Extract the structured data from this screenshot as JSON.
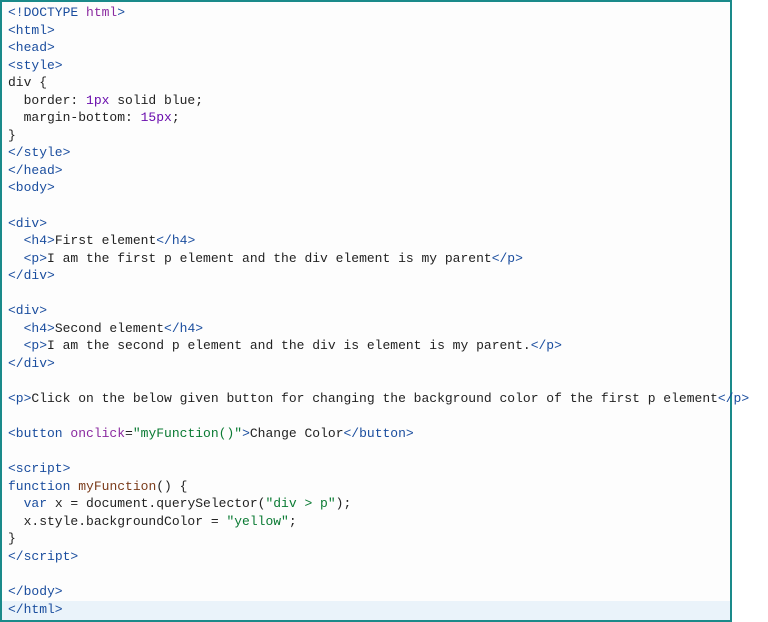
{
  "code": {
    "lines": [
      [
        [
          "tag",
          "<!DOCTYPE"
        ],
        [
          "plain",
          " "
        ],
        [
          "attr",
          "html"
        ],
        [
          "tag",
          ">"
        ]
      ],
      [
        [
          "tag",
          "<html>"
        ]
      ],
      [
        [
          "tag",
          "<head>"
        ]
      ],
      [
        [
          "tag",
          "<style>"
        ]
      ],
      [
        [
          "plain",
          "div {"
        ]
      ],
      [
        [
          "plain",
          "  border: "
        ],
        [
          "num",
          "1px"
        ],
        [
          "plain",
          " solid "
        ],
        [
          "plain",
          "blue"
        ],
        [
          "plain",
          ";"
        ]
      ],
      [
        [
          "plain",
          "  margin-bottom: "
        ],
        [
          "num",
          "15px"
        ],
        [
          "plain",
          ";"
        ]
      ],
      [
        [
          "plain",
          "}"
        ]
      ],
      [
        [
          "tag",
          "</style>"
        ]
      ],
      [
        [
          "tag",
          "</head>"
        ]
      ],
      [
        [
          "tag",
          "<body>"
        ]
      ],
      [
        [
          "plain",
          ""
        ]
      ],
      [
        [
          "tag",
          "<div>"
        ]
      ],
      [
        [
          "plain",
          "  "
        ],
        [
          "tag",
          "<h4>"
        ],
        [
          "plain",
          "First element"
        ],
        [
          "tag",
          "</h4>"
        ]
      ],
      [
        [
          "plain",
          "  "
        ],
        [
          "tag",
          "<p>"
        ],
        [
          "plain",
          "I am the first p element and the div element is my parent"
        ],
        [
          "tag",
          "</p>"
        ]
      ],
      [
        [
          "tag",
          "</div>"
        ]
      ],
      [
        [
          "plain",
          ""
        ]
      ],
      [
        [
          "tag",
          "<div>"
        ]
      ],
      [
        [
          "plain",
          "  "
        ],
        [
          "tag",
          "<h4>"
        ],
        [
          "plain",
          "Second element"
        ],
        [
          "tag",
          "</h4>"
        ]
      ],
      [
        [
          "plain",
          "  "
        ],
        [
          "tag",
          "<p>"
        ],
        [
          "plain",
          "I am the second p element and the div is element is my parent."
        ],
        [
          "tag",
          "</p>"
        ]
      ],
      [
        [
          "tag",
          "</div>"
        ]
      ],
      [
        [
          "plain",
          ""
        ]
      ],
      [
        [
          "tag",
          "<p>"
        ],
        [
          "plain",
          "Click on the below given button for changing the background color of the first p element"
        ],
        [
          "tag",
          "</p>"
        ]
      ],
      [
        [
          "plain",
          ""
        ]
      ],
      [
        [
          "tag",
          "<button"
        ],
        [
          "plain",
          " "
        ],
        [
          "attr",
          "onclick"
        ],
        [
          "plain",
          "="
        ],
        [
          "str",
          "\"myFunction()\""
        ],
        [
          "tag",
          ">"
        ],
        [
          "plain",
          "Change Color"
        ],
        [
          "tag",
          "</button>"
        ]
      ],
      [
        [
          "plain",
          ""
        ]
      ],
      [
        [
          "tag",
          "<script>"
        ]
      ],
      [
        [
          "kw",
          "function"
        ],
        [
          "plain",
          " "
        ],
        [
          "fn",
          "myFunction"
        ],
        [
          "plain",
          "() {"
        ]
      ],
      [
        [
          "plain",
          "  "
        ],
        [
          "kw",
          "var"
        ],
        [
          "plain",
          " x = document.querySelector("
        ],
        [
          "str",
          "\"div > p\""
        ],
        [
          "plain",
          ");"
        ]
      ],
      [
        [
          "plain",
          "  x.style.backgroundColor = "
        ],
        [
          "str",
          "\"yellow\""
        ],
        [
          "plain",
          ";"
        ]
      ],
      [
        [
          "plain",
          "}"
        ]
      ],
      [
        [
          "tag",
          "</"
        ],
        [
          "tag",
          "script>"
        ]
      ],
      [
        [
          "plain",
          ""
        ]
      ],
      [
        [
          "tag",
          "</body>"
        ]
      ],
      [
        [
          "tag",
          "</html>"
        ]
      ]
    ]
  }
}
